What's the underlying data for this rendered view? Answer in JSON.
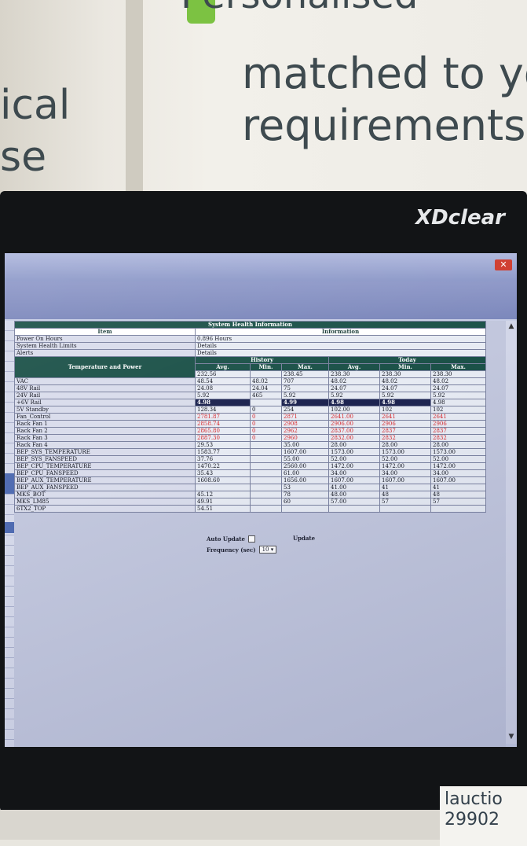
{
  "poster": {
    "line1": "Personalised",
    "line2": "matched to yo",
    "line3": "requirements",
    "left_line1": "ical",
    "left_line2": "se"
  },
  "monitor": {
    "brand": "XDclear"
  },
  "window": {
    "close_icon": "close-icon"
  },
  "table": {
    "title": "System Health Information",
    "item_header": "Item",
    "info_header": "Information",
    "rows_info": [
      {
        "label": "Power On Hours",
        "value": "0.896 Hours"
      },
      {
        "label": "System Health Limits",
        "value": "Details"
      },
      {
        "label": "Alerts",
        "value": "Details"
      }
    ],
    "tp_header": "Temperature and Power",
    "history_header": "History",
    "today_header": "Today",
    "cols": [
      "Avg.",
      "Min.",
      "Max.",
      "Avg.",
      "Min.",
      "Max."
    ],
    "top_values": [
      "232.56",
      "",
      "238.45",
      "238.30",
      "238.30",
      "238.30"
    ],
    "rows": [
      {
        "label": "VAC",
        "v": [
          "48.54",
          "48.02",
          "707",
          "48.02",
          "48.02",
          "48.02"
        ],
        "red": false
      },
      {
        "label": "48V Rail",
        "v": [
          "24.08",
          "24.04",
          "75",
          "24.07",
          "24.07",
          "24.07"
        ],
        "red": false
      },
      {
        "label": "24V Rail",
        "v": [
          "5.92",
          "465",
          "5.92",
          "5.92",
          "5.92",
          "5.92"
        ],
        "red": false
      },
      {
        "label": "+6V Rail",
        "v": [
          "4.98",
          "",
          "4.99",
          "4.98",
          "4.98",
          "4.98"
        ],
        "red": false,
        "hl": true
      },
      {
        "label": "5V Standby",
        "v": [
          "128.34",
          "0",
          "254",
          "102.00",
          "102",
          "102"
        ],
        "red": false
      },
      {
        "label": "Fan_Control",
        "v": [
          "2781.87",
          "0",
          "2871",
          "2641.00",
          "2641",
          "2641"
        ],
        "red": true
      },
      {
        "label": "Rack Fan 1",
        "v": [
          "2858.74",
          "0",
          "2908",
          "2906.00",
          "2906",
          "2906"
        ],
        "red": true
      },
      {
        "label": "Rack Fan 2",
        "v": [
          "2865.80",
          "0",
          "2962",
          "2837.00",
          "2837",
          "2837"
        ],
        "red": true
      },
      {
        "label": "Rack Fan 3",
        "v": [
          "2887.30",
          "0",
          "2960",
          "2832.00",
          "2832",
          "2832"
        ],
        "red": true
      },
      {
        "label": "Rack Fan 4",
        "v": [
          "29.53",
          "",
          "35.00",
          "28.00",
          "28.00",
          "28.00"
        ],
        "red": false
      },
      {
        "label": "BEP_SYS_TEMPERATURE",
        "v": [
          "1583.77",
          "",
          "1607.00",
          "1573.00",
          "1573.00",
          "1573.00"
        ],
        "red": false
      },
      {
        "label": "BEP_SYS_FANSPEED",
        "v": [
          "37.76",
          "",
          "55.00",
          "52.00",
          "52.00",
          "52.00"
        ],
        "red": false
      },
      {
        "label": "BEP_CPU_TEMPERATURE",
        "v": [
          "1470.22",
          "",
          "2560.00",
          "1472.00",
          "1472.00",
          "1472.00"
        ],
        "red": false
      },
      {
        "label": "BEP_CPU_FANSPEED",
        "v": [
          "35.43",
          "",
          "61.00",
          "34.00",
          "34.00",
          "34.00"
        ],
        "red": false
      },
      {
        "label": "BEP_AUX_TEMPERATURE",
        "v": [
          "1608.60",
          "",
          "1656.00",
          "1607.00",
          "1607.00",
          "1607.00"
        ],
        "red": false
      },
      {
        "label": "BEP_AUX_FANSPEED",
        "v": [
          "",
          "",
          "53",
          "41.00",
          "41",
          "41"
        ],
        "red": false
      },
      {
        "label": "MKS_BOT",
        "v": [
          "45.12",
          "",
          "78",
          "48.00",
          "48",
          "48"
        ],
        "red": false
      },
      {
        "label": "MKS_LM85",
        "v": [
          "49.91",
          "",
          "60",
          "57.00",
          "57",
          "57"
        ],
        "red": false
      },
      {
        "label": "6TX2_TOP",
        "v": [
          "54.51",
          "",
          "",
          "",
          "",
          ""
        ],
        "red": false
      }
    ]
  },
  "controls": {
    "auto_update_label": "Auto Update",
    "frequency_label": "Frequency (sec)",
    "frequency_value": "10",
    "update_label": "Update"
  },
  "bottom_card": {
    "line1": "lauctio",
    "line2": "29902"
  }
}
